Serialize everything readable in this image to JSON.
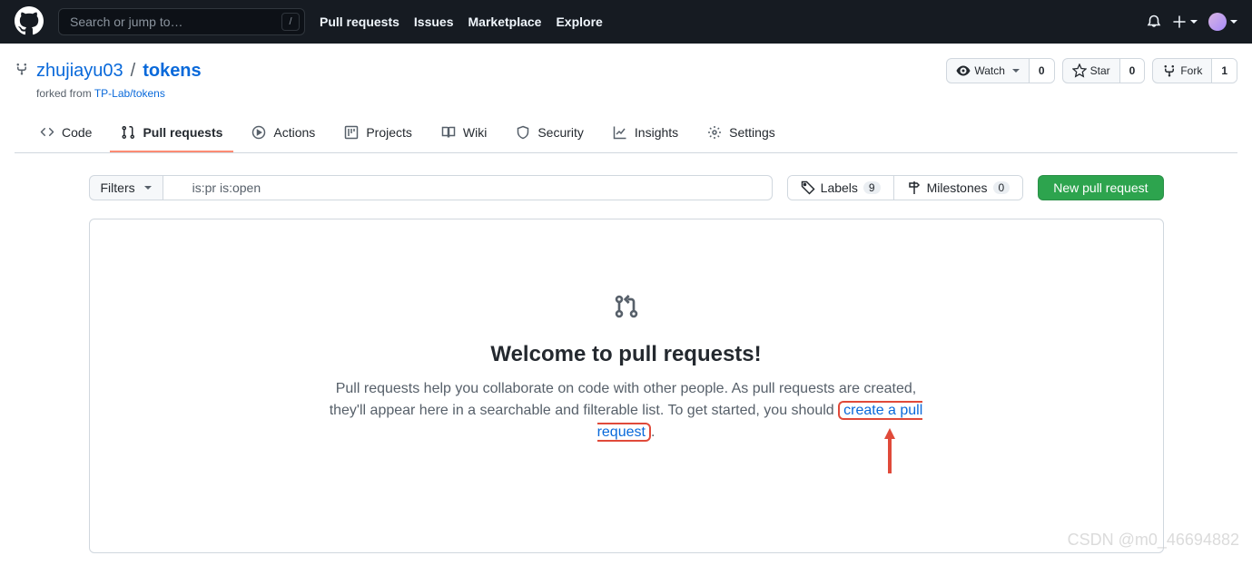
{
  "header": {
    "search_placeholder": "Search or jump to…",
    "slash": "/",
    "nav": [
      "Pull requests",
      "Issues",
      "Marketplace",
      "Explore"
    ]
  },
  "repo": {
    "owner": "zhujiayu03",
    "sep": "/",
    "name": "tokens",
    "forked_prefix": "forked from ",
    "forked_link": "TP-Lab/tokens",
    "actions": {
      "watch": {
        "label": "Watch",
        "count": "0"
      },
      "star": {
        "label": "Star",
        "count": "0"
      },
      "fork": {
        "label": "Fork",
        "count": "1"
      }
    }
  },
  "tabs": {
    "code": "Code",
    "pulls": "Pull requests",
    "actions": "Actions",
    "projects": "Projects",
    "wiki": "Wiki",
    "security": "Security",
    "insights": "Insights",
    "settings": "Settings"
  },
  "pr": {
    "filters": "Filters",
    "search_value": "is:pr is:open",
    "labels": {
      "label": "Labels",
      "count": "9"
    },
    "milestones": {
      "label": "Milestones",
      "count": "0"
    },
    "new_btn": "New pull request"
  },
  "blankslate": {
    "title": "Welcome to pull requests!",
    "body_a": "Pull requests help you collaborate on code with other people. As pull requests are created, they'll appear here in a searchable and filterable list. To get started, you should ",
    "link": "create a pull request",
    "body_b": "."
  },
  "watermark": "CSDN @m0_46694882"
}
